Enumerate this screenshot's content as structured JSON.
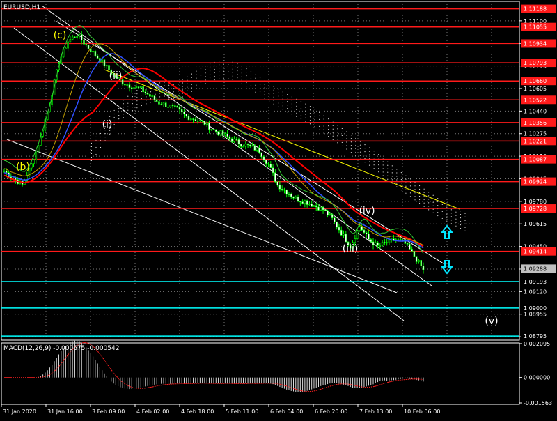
{
  "chart_data": [
    {
      "type": "candlestick",
      "title": "EURUSD,H1",
      "x_tick_labels": [
        "31 Jan 2020",
        "31 Jan 16:00",
        "3 Feb 09:00",
        "4 Feb 02:00",
        "4 Feb 18:00",
        "5 Feb 11:00",
        "6 Feb 04:00",
        "6 Feb 20:00",
        "7 Feb 13:00",
        "10 Feb 06:00"
      ],
      "ylim": [
        1.08765,
        1.11242
      ],
      "y_tick_labels": [
        "1.11100",
        "1.10935",
        "1.10770",
        "1.10605",
        "1.10440",
        "1.10275",
        "1.10110",
        "1.09945",
        "1.09780",
        "1.09615",
        "1.09450",
        "1.09285",
        "1.09120",
        "1.08955",
        "1.08790"
      ],
      "price_levels": [
        {
          "label": "1.11188",
          "color": "red"
        },
        {
          "label": "1.11055",
          "color": "red"
        },
        {
          "label": "1.10934",
          "color": "red"
        },
        {
          "label": "1.10793",
          "color": "red"
        },
        {
          "label": "1.10660",
          "color": "red"
        },
        {
          "label": "1.10522",
          "color": "red"
        },
        {
          "label": "1.10356",
          "color": "red"
        },
        {
          "label": "1.10221",
          "color": "red"
        },
        {
          "label": "1.10087",
          "color": "red"
        },
        {
          "label": "1.09924",
          "color": "red"
        },
        {
          "label": "1.09728",
          "color": "red"
        },
        {
          "label": "1.09414",
          "color": "red"
        },
        {
          "label": "1.09193",
          "color": "cyan"
        },
        {
          "label": "1.09000",
          "color": "cyan"
        },
        {
          "label": "1.08795",
          "color": "cyan"
        }
      ],
      "current_price": "1.09288",
      "wave_labels": [
        "(c)",
        "(b)",
        "(i)",
        "(ii)",
        "(iii)",
        "(iv)",
        "(v)"
      ],
      "close_series": [
        1.1,
        1.0995,
        1.099,
        1.1005,
        1.1025,
        1.105,
        1.108,
        1.1095,
        1.11,
        1.1092,
        1.1085,
        1.1078,
        1.107,
        1.1065,
        1.1062,
        1.106,
        1.1055,
        1.105,
        1.1048,
        1.1045,
        1.104,
        1.1038,
        1.1035,
        1.103,
        1.1027,
        1.1023,
        1.102,
        1.1018,
        1.1015,
        1.1005,
        1.099,
        1.0985,
        1.098,
        1.0978,
        1.0975,
        1.0972,
        1.0965,
        1.0955,
        1.0945,
        1.096,
        1.095,
        1.0945,
        1.0948,
        1.095,
        1.0947,
        1.0938,
        1.0928
      ],
      "macd": {
        "label": "MACD(12,26,9) -0.000675 -0.000542",
        "ylim": [
          -0.001563,
          0.00205
        ],
        "y_tick_labels": [
          "0.002095",
          "0.000000",
          "-0.001563"
        ]
      }
    }
  ]
}
